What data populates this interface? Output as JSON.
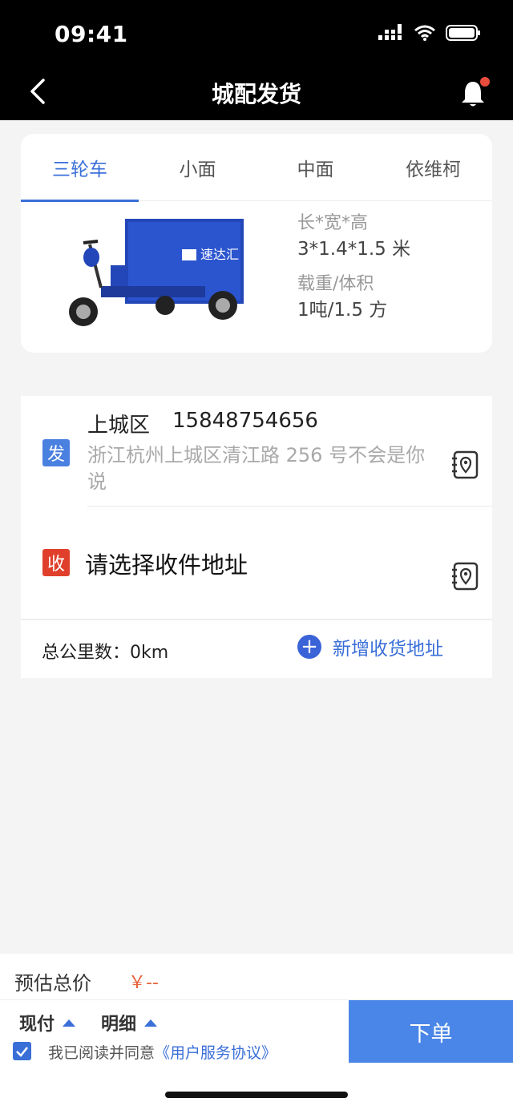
{
  "status_bar": {
    "time": "09:41"
  },
  "nav": {
    "title": "城配发货"
  },
  "vehicle_tabs": [
    "三轮车",
    "小面",
    "中面",
    "依维柯"
  ],
  "vehicle": {
    "brand_text": "速达汇",
    "size_label": "长*宽*高",
    "size_value": "3*1.4*1.5 米",
    "load_label": "载重/体积",
    "load_value": "1吨/1.5 方"
  },
  "sender": {
    "badge": "发",
    "district": "上城区",
    "phone": "15848754656",
    "address": "浙江杭州上城区清江路 256 号不会是你说"
  },
  "receiver": {
    "badge": "收",
    "prompt": "请选择收件地址"
  },
  "summary": {
    "km_label": "总公里数：0km",
    "add_address": "新增收货地址"
  },
  "bottom": {
    "estimate_label": "预估总价",
    "estimate_value": "￥--",
    "payment": "现付",
    "detail": "明细",
    "agree_text": "我已阅读并同意",
    "agreement_link": "《用户服务协议》",
    "order_button": "下单"
  },
  "colors": {
    "accent": "#3a6fd8",
    "send_badge": "#4a80e0",
    "recv_badge": "#e0402b",
    "price": "#e6643a"
  }
}
